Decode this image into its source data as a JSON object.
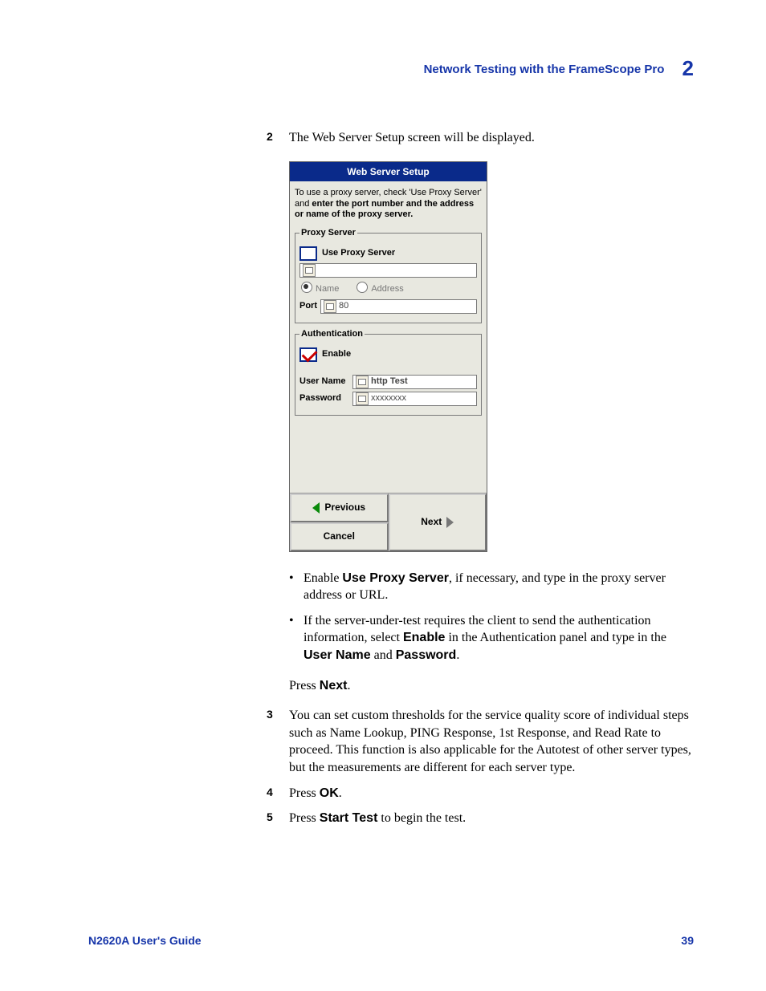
{
  "header": {
    "title": "Network Testing with the FrameScope Pro",
    "chapter": "2"
  },
  "steps": {
    "s2": {
      "num": "2",
      "text": "The Web Server Setup screen will be displayed."
    },
    "s3": {
      "num": "3",
      "text": "You can set custom thresholds for the service quality score of individual steps such as Name Lookup, PING Response, 1st Response, and Read Rate to proceed. This function is also applicable for the Autotest of other server types, but the measurements are different for each server type."
    },
    "s4": {
      "num": "4",
      "pre": "Press ",
      "bold": "OK",
      "post": "."
    },
    "s5": {
      "num": "5",
      "pre": "Press ",
      "bold": "Start Test",
      "post": " to begin the test."
    }
  },
  "screen": {
    "title": "Web Server Setup",
    "instr_a": "To use a proxy server, check 'Use Proxy Server' and ",
    "instr_b": "enter the port number and the address or name of the proxy server.",
    "group_proxy": "Proxy Server",
    "use_proxy": "Use Proxy Server",
    "radio_name": "Name",
    "radio_addr": "Address",
    "port_lbl": "Port",
    "port_val": "80",
    "group_auth": "Authentication",
    "enable": "Enable",
    "user_lbl": "User Name",
    "user_val": "http Test",
    "pass_lbl": "Password",
    "pass_val": "xxxxxxxx",
    "btn_prev": "Previous",
    "btn_next": "Next",
    "btn_cancel": "Cancel"
  },
  "bullets": {
    "b1_a": "Enable ",
    "b1_bold": "Use Proxy Server",
    "b1_b": ", if necessary, and type in the proxy server address or URL.",
    "b2_a": "If the server-under-test requires the client to send the authentication information, select ",
    "b2_bold1": "Enable",
    "b2_b": " in the Authentication panel and type in the ",
    "b2_bold2": "User Name",
    "b2_c": " and ",
    "b2_bold3": "Password",
    "b2_d": "."
  },
  "press_next": {
    "a": "Press ",
    "b": "Next",
    "c": "."
  },
  "footer": {
    "guide": "N2620A User's Guide",
    "page": "39"
  }
}
